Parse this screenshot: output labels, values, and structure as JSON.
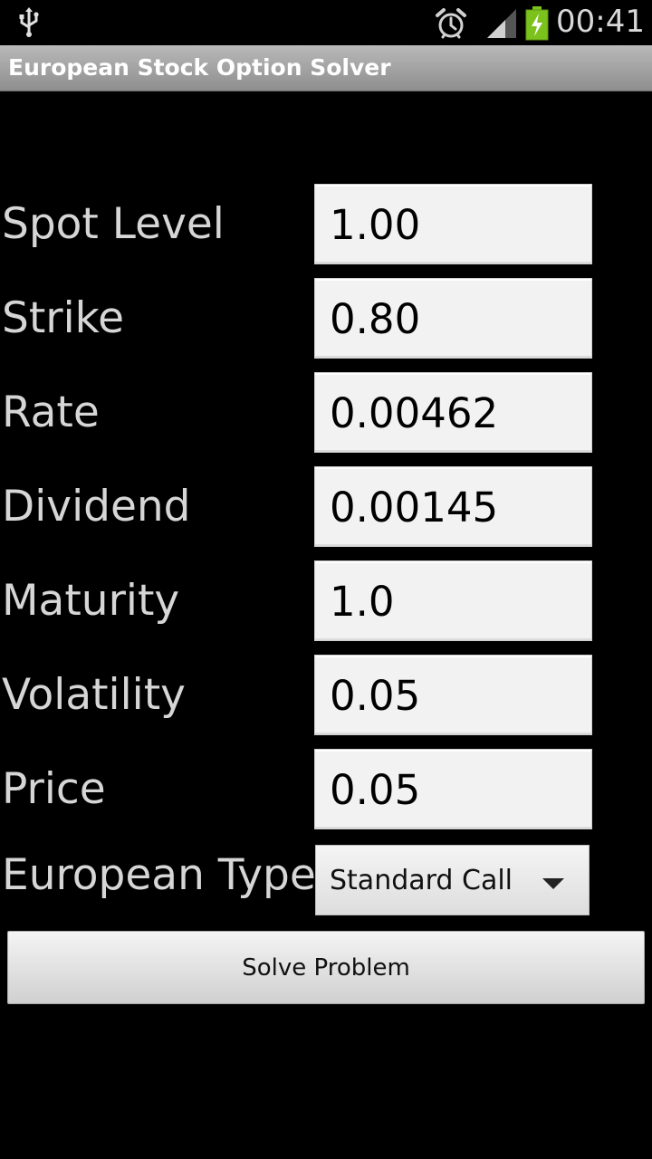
{
  "status_bar": {
    "time": "00:41",
    "icons": [
      "usb-icon",
      "alarm-icon",
      "signal-icon",
      "battery-charging-icon"
    ]
  },
  "app": {
    "title": "European Stock Option Solver"
  },
  "form": {
    "fields": [
      {
        "label": "Spot Level",
        "value": "1.00"
      },
      {
        "label": "Strike",
        "value": "0.80"
      },
      {
        "label": "Rate",
        "value": "0.00462"
      },
      {
        "label": "Dividend",
        "value": "0.00145"
      },
      {
        "label": "Maturity",
        "value": "1.0"
      },
      {
        "label": "Volatility",
        "value": "0.05"
      },
      {
        "label": "Price",
        "value": "0.05"
      }
    ],
    "type_label": "European Type",
    "type_selected": "Standard Call",
    "solve_label": "Solve Problem"
  },
  "colors": {
    "background": "#000000",
    "title_bar": "#a6a6a6",
    "input_background": "#f2f2f2",
    "label_text": "#d6d6d6",
    "battery_green": "#7cc21d"
  }
}
